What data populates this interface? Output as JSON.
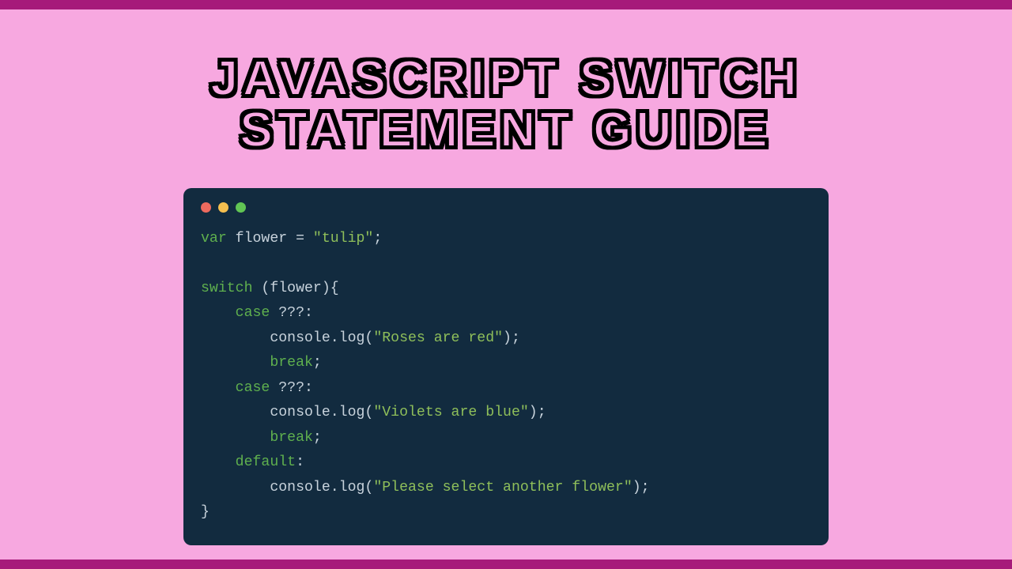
{
  "title": {
    "line1": "JAVASCRIPT SWITCH",
    "line2": "STATEMENT GUIDE"
  },
  "window": {
    "dots": [
      "close",
      "minimize",
      "maximize"
    ]
  },
  "code": {
    "tokens": [
      {
        "t": "var ",
        "c": "kw"
      },
      {
        "t": "flower",
        "c": "id"
      },
      {
        "t": " = ",
        "c": "pun"
      },
      {
        "t": "\"tulip\"",
        "c": "str"
      },
      {
        "t": ";",
        "c": "pun"
      },
      {
        "t": "\n",
        "c": "nl"
      },
      {
        "t": "\n",
        "c": "nl"
      },
      {
        "t": "switch ",
        "c": "kw"
      },
      {
        "t": "(",
        "c": "pun"
      },
      {
        "t": "flower",
        "c": "id"
      },
      {
        "t": "){",
        "c": "pun"
      },
      {
        "t": "\n",
        "c": "nl"
      },
      {
        "t": "    ",
        "c": "pun"
      },
      {
        "t": "case ",
        "c": "kw"
      },
      {
        "t": "???",
        "c": "unk"
      },
      {
        "t": ":",
        "c": "pun"
      },
      {
        "t": "\n",
        "c": "nl"
      },
      {
        "t": "        ",
        "c": "pun"
      },
      {
        "t": "console",
        "c": "id"
      },
      {
        "t": ".",
        "c": "pun"
      },
      {
        "t": "log",
        "c": "fn"
      },
      {
        "t": "(",
        "c": "pun"
      },
      {
        "t": "\"Roses are red\"",
        "c": "str"
      },
      {
        "t": ");",
        "c": "pun"
      },
      {
        "t": "\n",
        "c": "nl"
      },
      {
        "t": "        ",
        "c": "pun"
      },
      {
        "t": "break",
        "c": "kw"
      },
      {
        "t": ";",
        "c": "pun"
      },
      {
        "t": "\n",
        "c": "nl"
      },
      {
        "t": "    ",
        "c": "pun"
      },
      {
        "t": "case ",
        "c": "kw"
      },
      {
        "t": "???",
        "c": "unk"
      },
      {
        "t": ":",
        "c": "pun"
      },
      {
        "t": "\n",
        "c": "nl"
      },
      {
        "t": "        ",
        "c": "pun"
      },
      {
        "t": "console",
        "c": "id"
      },
      {
        "t": ".",
        "c": "pun"
      },
      {
        "t": "log",
        "c": "fn"
      },
      {
        "t": "(",
        "c": "pun"
      },
      {
        "t": "\"Violets are blue\"",
        "c": "str"
      },
      {
        "t": ");",
        "c": "pun"
      },
      {
        "t": "\n",
        "c": "nl"
      },
      {
        "t": "        ",
        "c": "pun"
      },
      {
        "t": "break",
        "c": "kw"
      },
      {
        "t": ";",
        "c": "pun"
      },
      {
        "t": "\n",
        "c": "nl"
      },
      {
        "t": "    ",
        "c": "pun"
      },
      {
        "t": "default",
        "c": "kw"
      },
      {
        "t": ":",
        "c": "pun"
      },
      {
        "t": "\n",
        "c": "nl"
      },
      {
        "t": "        ",
        "c": "pun"
      },
      {
        "t": "console",
        "c": "id"
      },
      {
        "t": ".",
        "c": "pun"
      },
      {
        "t": "log",
        "c": "fn"
      },
      {
        "t": "(",
        "c": "pun"
      },
      {
        "t": "\"Please select another flower\"",
        "c": "str"
      },
      {
        "t": ");",
        "c": "pun"
      },
      {
        "t": "\n",
        "c": "nl"
      },
      {
        "t": "}",
        "c": "pun"
      }
    ]
  }
}
